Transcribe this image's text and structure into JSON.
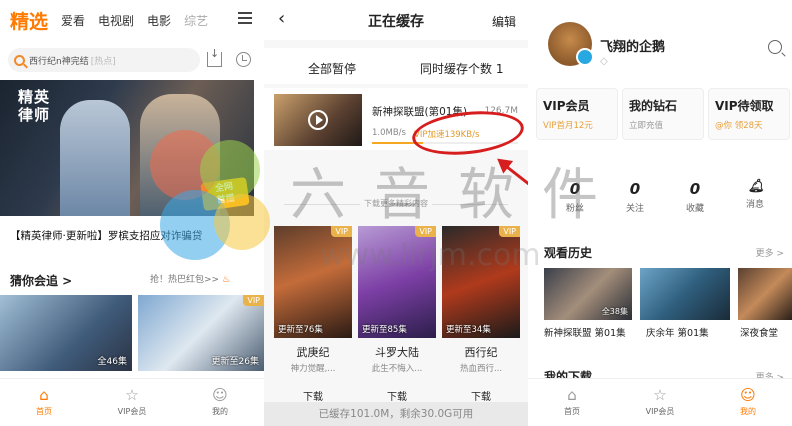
{
  "panel1": {
    "tabs": [
      "精选",
      "爱看",
      "电视剧",
      "电影",
      "综艺"
    ],
    "search": {
      "value": "西行纪n神完结",
      "placeholder": "[热点]"
    },
    "banner": {
      "logo_line1": "精英",
      "logo_line2": "律师",
      "corner_line1": "全网",
      "corner_line2": "首播"
    },
    "caption": "【精英律师·更新啦】罗槟支招应对诈骗贷",
    "hint": "抢！热巴红包>>",
    "section_title": "猜你会追 >",
    "cards": [
      {
        "label": "全46集",
        "tag": ""
      },
      {
        "label": "更新至26集",
        "tag": "VIP"
      }
    ],
    "bottom_tabs": [
      {
        "icon": "home-icon",
        "label": "首页"
      },
      {
        "icon": "star-icon",
        "label": "VIP会员"
      },
      {
        "icon": "smile-icon",
        "label": "我的"
      }
    ]
  },
  "panel2": {
    "title": "正在缓存",
    "edit": "编辑",
    "pause_all": "全部暂停",
    "concurrent": "同时缓存个数 1",
    "item": {
      "name": "新神探联盟(第01集)",
      "size": "126.7M",
      "speed": "1.0MB/s",
      "vip_speed": "VIP加速139KB/s",
      "progress": 0.35
    },
    "more_label": "下载更多精彩内容",
    "posters": [
      {
        "update": "更新至76集",
        "title": "武庚纪",
        "subtitle": "神力觉醒,...",
        "download": "下载",
        "vip": "VIP"
      },
      {
        "update": "更新至85集",
        "title": "斗罗大陆",
        "subtitle": "此生不悔入...",
        "download": "下载",
        "vip": "VIP"
      },
      {
        "update": "更新至34集",
        "title": "西行纪",
        "subtitle": "热血西行...",
        "download": "下载",
        "vip": "VIP"
      }
    ],
    "footer": "已缓存101.0M，剩余30.0G可用"
  },
  "panel3": {
    "username": "飞翔的企鹅",
    "vip_boxes": [
      {
        "title": "VIP会员",
        "sub": "VIP首月12元"
      },
      {
        "title": "我的钻石",
        "sub": "立即充值"
      },
      {
        "title": "VIP待领取",
        "sub": "@你 领28天"
      }
    ],
    "stats": [
      {
        "value": "0",
        "label": "粉丝"
      },
      {
        "value": "0",
        "label": "关注"
      },
      {
        "value": "0",
        "label": "收藏"
      },
      {
        "value": "",
        "label": "消息"
      }
    ],
    "history_title": "观看历史",
    "history_more": "更多 >",
    "history": [
      {
        "ep": "全38集",
        "title": "新神探联盟 第01集"
      },
      {
        "ep": "",
        "title": "庆余年 第01集"
      },
      {
        "ep": "",
        "title": "深夜食堂"
      }
    ],
    "downloads_title": "我的下载",
    "downloads_more": "更多 >",
    "bottom_tabs": [
      {
        "icon": "home-icon",
        "label": "首页"
      },
      {
        "icon": "star-icon",
        "label": "VIP会员"
      },
      {
        "icon": "smile-icon",
        "label": "我的"
      }
    ]
  },
  "watermark": {
    "text": "六音软件",
    "url": "www.llrjm.com"
  },
  "colors": {
    "accent": "#ff7a00",
    "vip_gold": "#e29b2d",
    "annotation_red": "#d61e1e"
  }
}
